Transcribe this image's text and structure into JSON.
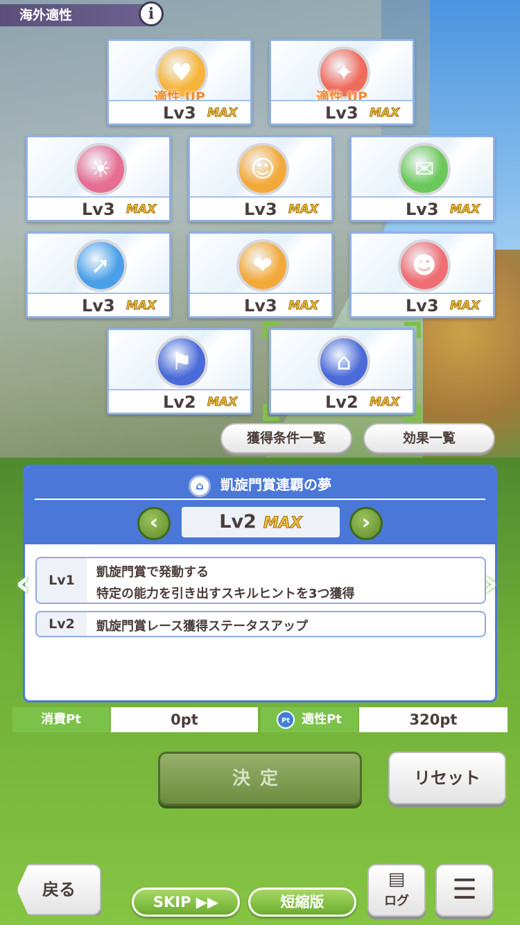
{
  "header": {
    "title": "海外適性"
  },
  "colors": {
    "accent_blue": "#4b78d8",
    "accent_green": "#7cc24a",
    "max_gold": "#f3c23c"
  },
  "cards": [
    {
      "name": "aptitude-up-1",
      "icon": "heart-hand-icon",
      "up_label": "適性 UP",
      "level": "Lv3",
      "max": "MAX",
      "medal_color": "#f6b43a"
    },
    {
      "name": "aptitude-up-2",
      "icon": "stadium-sparkle-icon",
      "up_label": "適性 UP",
      "level": "Lv3",
      "max": "MAX",
      "medal_color": "#ef6b5c"
    },
    {
      "name": "sun-moon",
      "icon": "sun-moon-icon",
      "level": "Lv3",
      "max": "MAX",
      "medal_color": "#e56e92"
    },
    {
      "name": "meal",
      "icon": "fork-knife-icon",
      "level": "Lv3",
      "max": "MAX",
      "medal_color": "#f3a93a"
    },
    {
      "name": "talk",
      "icon": "chat-bubble-icon",
      "level": "Lv3",
      "max": "MAX",
      "medal_color": "#6cc85a"
    },
    {
      "name": "stairs",
      "icon": "stairs-arrow-icon",
      "level": "Lv3",
      "max": "MAX",
      "medal_color": "#4aa0e8"
    },
    {
      "name": "heart",
      "icon": "heart-icon",
      "level": "Lv3",
      "max": "MAX",
      "medal_color": "#f3a93a"
    },
    {
      "name": "devil",
      "icon": "devil-face-icon",
      "level": "Lv3",
      "max": "MAX",
      "medal_color": "#ee6e74"
    },
    {
      "name": "flag",
      "icon": "flag-icon",
      "level": "Lv2",
      "max": "MAX",
      "medal_color": "#4a6ad8"
    },
    {
      "name": "arc-de-triomphe",
      "icon": "arch-icon",
      "level": "Lv2",
      "max": "MAX",
      "medal_color": "#4a6ad8"
    }
  ],
  "buttons": {
    "conditions": "獲得条件一覧",
    "effects": "効果一覧",
    "decide": "決定",
    "reset": "リセット",
    "back": "戻る",
    "skip": "SKIP ▶▶",
    "short": "短縮版",
    "log": "ログ"
  },
  "detail": {
    "title": "凱旋門賞連覇の夢",
    "level": "Lv2",
    "max": "MAX",
    "rows": [
      {
        "tag": "Lv1",
        "line1": "凱旋門賞で発動する",
        "line2": "特定の能力を引き出すスキルヒントを3つ獲得"
      },
      {
        "tag": "Lv2",
        "line1": "凱旋門賞レース獲得ステータスアップ"
      }
    ]
  },
  "points": {
    "cost_label": "消費Pt",
    "cost_value": "0pt",
    "apt_label": "適性Pt",
    "apt_value": "320pt",
    "pt_icon_text": "Pt"
  }
}
